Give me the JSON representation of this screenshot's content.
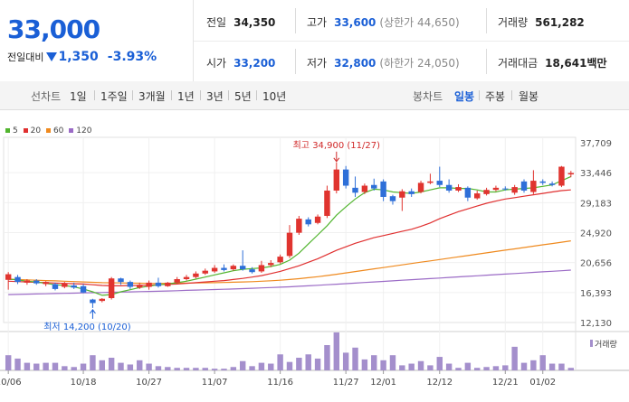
{
  "summary": {
    "price": "33,000",
    "change_label": "전일대비",
    "change_value": "1,350",
    "change_pct": "-3.93%",
    "prev_close": {
      "label": "전일",
      "value": "34,350"
    },
    "high": {
      "label": "고가",
      "value": "33,600",
      "ext": "(상한가 44,650)"
    },
    "volume": {
      "label": "거래량",
      "value": "561,282"
    },
    "open": {
      "label": "시가",
      "value": "33,200"
    },
    "low": {
      "label": "저가",
      "value": "32,800",
      "ext": "(하한가 24,050)"
    },
    "amount": {
      "label": "거래대금",
      "value": "18,641",
      "unit": "백만"
    }
  },
  "toolbar": {
    "line_label": "선차트",
    "line_periods": [
      "1일",
      "1주일",
      "3개월",
      "1년",
      "3년",
      "5년",
      "10년"
    ],
    "candle_label": "봉차트",
    "candle_periods": [
      "일봉",
      "주봉",
      "월봉"
    ],
    "candle_selected": "일봉"
  },
  "chart_data": {
    "type": "candlestick",
    "ma_legend": [
      {
        "name": "5",
        "color": "#52b52f"
      },
      {
        "name": "20",
        "color": "#e03030"
      },
      {
        "name": "60",
        "color": "#ef8a1f"
      },
      {
        "name": "120",
        "color": "#9b6bc6"
      }
    ],
    "y_ticks": [
      "37,709",
      "33,446",
      "29,183",
      "24,920",
      "20,656",
      "16,393",
      "12,130"
    ],
    "y_range": [
      12130,
      37709
    ],
    "x_ticks": [
      {
        "label": "10/06",
        "index": 0
      },
      {
        "label": "10/18",
        "index": 8
      },
      {
        "label": "10/27",
        "index": 15
      },
      {
        "label": "11/07",
        "index": 22
      },
      {
        "label": "11/16",
        "index": 29
      },
      {
        "label": "11/27",
        "index": 36
      },
      {
        "label": "12/01",
        "index": 40
      },
      {
        "label": "12/12",
        "index": 46
      },
      {
        "label": "12/21",
        "index": 53
      },
      {
        "label": "01/02",
        "index": 57
      }
    ],
    "volume_label": "거래량",
    "annotations": {
      "high": {
        "text": "최고 34,900 (11/27)",
        "index": 35,
        "value": 34900
      },
      "low": {
        "text": "최저 14,200 (10/20)",
        "index": 9,
        "value": 14200
      }
    },
    "candles": [
      {
        "o": 18200,
        "c": 19000,
        "h": 19300,
        "l": 16800
      },
      {
        "o": 18600,
        "c": 17900,
        "h": 18900,
        "l": 17600
      },
      {
        "o": 17800,
        "c": 18100,
        "h": 18300,
        "l": 17500
      },
      {
        "o": 18100,
        "c": 17700,
        "h": 18300,
        "l": 17500
      },
      {
        "o": 17600,
        "c": 17900,
        "h": 18000,
        "l": 17300
      },
      {
        "o": 17600,
        "c": 16900,
        "h": 17800,
        "l": 16700
      },
      {
        "o": 17200,
        "c": 17700,
        "h": 17900,
        "l": 17000
      },
      {
        "o": 17400,
        "c": 17100,
        "h": 17800,
        "l": 16900
      },
      {
        "o": 17300,
        "c": 16400,
        "h": 17600,
        "l": 16300
      },
      {
        "o": 15400,
        "c": 14900,
        "h": 15500,
        "l": 14200
      },
      {
        "o": 15200,
        "c": 15500,
        "h": 15600,
        "l": 15000
      },
      {
        "o": 15600,
        "c": 18400,
        "h": 18600,
        "l": 15400
      },
      {
        "o": 18400,
        "c": 17900,
        "h": 18500,
        "l": 17500
      },
      {
        "o": 17900,
        "c": 17200,
        "h": 18100,
        "l": 16900
      },
      {
        "o": 17100,
        "c": 17500,
        "h": 17800,
        "l": 16900
      },
      {
        "o": 17200,
        "c": 17800,
        "h": 18100,
        "l": 16800
      },
      {
        "o": 17800,
        "c": 17300,
        "h": 18500,
        "l": 17100
      },
      {
        "o": 17300,
        "c": 17800,
        "h": 17900,
        "l": 17200
      },
      {
        "o": 17800,
        "c": 18300,
        "h": 18600,
        "l": 17600
      },
      {
        "o": 18300,
        "c": 18600,
        "h": 18900,
        "l": 18100
      },
      {
        "o": 18600,
        "c": 19100,
        "h": 19400,
        "l": 18400
      },
      {
        "o": 19100,
        "c": 19500,
        "h": 19800,
        "l": 18900
      },
      {
        "o": 19400,
        "c": 19900,
        "h": 20300,
        "l": 19200
      },
      {
        "o": 19900,
        "c": 19600,
        "h": 20400,
        "l": 19400
      },
      {
        "o": 19700,
        "c": 20200,
        "h": 20400,
        "l": 19500
      },
      {
        "o": 20200,
        "c": 19700,
        "h": 22400,
        "l": 19500
      },
      {
        "o": 19700,
        "c": 19300,
        "h": 20000,
        "l": 19100
      },
      {
        "o": 19400,
        "c": 20300,
        "h": 20900,
        "l": 19200
      },
      {
        "o": 20300,
        "c": 20600,
        "h": 21000,
        "l": 20000
      },
      {
        "o": 20700,
        "c": 21500,
        "h": 21800,
        "l": 20500
      },
      {
        "o": 21600,
        "c": 24900,
        "h": 26000,
        "l": 21300
      },
      {
        "o": 24900,
        "c": 26900,
        "h": 27300,
        "l": 24600
      },
      {
        "o": 26800,
        "c": 26100,
        "h": 27100,
        "l": 25800
      },
      {
        "o": 26300,
        "c": 27200,
        "h": 27500,
        "l": 26100
      },
      {
        "o": 27300,
        "c": 30900,
        "h": 31600,
        "l": 27000
      },
      {
        "o": 30900,
        "c": 33900,
        "h": 34900,
        "l": 30500
      },
      {
        "o": 33900,
        "c": 31600,
        "h": 34400,
        "l": 31200
      },
      {
        "o": 31300,
        "c": 30600,
        "h": 32900,
        "l": 30000
      },
      {
        "o": 30700,
        "c": 31600,
        "h": 31900,
        "l": 30400
      },
      {
        "o": 31700,
        "c": 31200,
        "h": 32600,
        "l": 30900
      },
      {
        "o": 32200,
        "c": 30000,
        "h": 32500,
        "l": 29400
      },
      {
        "o": 30100,
        "c": 29400,
        "h": 30300,
        "l": 28900
      },
      {
        "o": 29900,
        "c": 30800,
        "h": 31100,
        "l": 28000
      },
      {
        "o": 30800,
        "c": 30400,
        "h": 31200,
        "l": 30000
      },
      {
        "o": 30700,
        "c": 32000,
        "h": 32300,
        "l": 30500
      },
      {
        "o": 32000,
        "c": 32200,
        "h": 33300,
        "l": 31800
      },
      {
        "o": 32300,
        "c": 31700,
        "h": 34300,
        "l": 31400
      },
      {
        "o": 31700,
        "c": 30900,
        "h": 32500,
        "l": 30600
      },
      {
        "o": 30900,
        "c": 31400,
        "h": 31800,
        "l": 30700
      },
      {
        "o": 31300,
        "c": 29900,
        "h": 31500,
        "l": 29400
      },
      {
        "o": 29800,
        "c": 30500,
        "h": 30900,
        "l": 29600
      },
      {
        "o": 30400,
        "c": 31000,
        "h": 31300,
        "l": 30200
      },
      {
        "o": 31000,
        "c": 31300,
        "h": 31600,
        "l": 30800
      },
      {
        "o": 31200,
        "c": 31100,
        "h": 31500,
        "l": 30900
      },
      {
        "o": 30600,
        "c": 31400,
        "h": 31700,
        "l": 30300
      },
      {
        "o": 32200,
        "c": 30900,
        "h": 32500,
        "l": 30600
      },
      {
        "o": 30700,
        "c": 32300,
        "h": 33800,
        "l": 30400
      },
      {
        "o": 32200,
        "c": 32000,
        "h": 32500,
        "l": 31700
      },
      {
        "o": 31900,
        "c": 31700,
        "h": 32200,
        "l": 31500
      },
      {
        "o": 31600,
        "c": 34300,
        "h": 34400,
        "l": 31400
      },
      {
        "o": 33200,
        "c": 33400,
        "h": 33700,
        "l": 32800
      }
    ],
    "volumes": [
      18,
      14,
      9,
      8,
      9,
      9,
      5,
      4,
      8,
      18,
      12,
      15,
      9,
      7,
      12,
      8,
      5,
      4,
      3,
      3,
      3,
      3,
      2,
      2,
      4,
      11,
      5,
      9,
      8,
      19,
      10,
      15,
      19,
      14,
      30,
      45,
      21,
      27,
      13,
      18,
      12,
      18,
      6,
      8,
      11,
      6,
      16,
      8,
      3,
      9,
      3,
      4,
      5,
      6,
      28,
      9,
      12,
      18,
      8,
      8,
      3
    ],
    "ma5": [
      18300,
      18200,
      18000,
      17900,
      17700,
      17500,
      17400,
      17200,
      16900,
      16500,
      16000,
      16100,
      16500,
      16800,
      17100,
      17300,
      17500,
      17600,
      17800,
      18000,
      18300,
      18600,
      18900,
      19200,
      19500,
      19700,
      19800,
      19900,
      20100,
      20400,
      21000,
      22000,
      23300,
      24600,
      25900,
      27400,
      28600,
      29700,
      30600,
      31100,
      31000,
      30700,
      30600,
      30500,
      30700,
      31000,
      31300,
      31300,
      31200,
      31200,
      31000,
      30700,
      30700,
      31000,
      31100,
      31200,
      31300,
      31500,
      31700,
      32300,
      32900
    ],
    "ma20": [
      18000,
      17950,
      17900,
      17850,
      17800,
      17750,
      17700,
      17650,
      17600,
      17500,
      17400,
      17350,
      17350,
      17400,
      17400,
      17450,
      17500,
      17550,
      17600,
      17700,
      17800,
      17900,
      18000,
      18100,
      18250,
      18400,
      18600,
      18800,
      19100,
      19400,
      19800,
      20200,
      20700,
      21200,
      21800,
      22400,
      22900,
      23400,
      23800,
      24200,
      24500,
      24800,
      25100,
      25400,
      25800,
      26300,
      26900,
      27400,
      27900,
      28300,
      28700,
      29100,
      29400,
      29700,
      29900,
      30100,
      30300,
      30500,
      30700,
      30900,
      31000
    ],
    "ma60": [
      18300,
      18250,
      18200,
      18150,
      18100,
      18050,
      18000,
      17950,
      17900,
      17850,
      17800,
      17780,
      17760,
      17740,
      17720,
      17700,
      17700,
      17710,
      17720,
      17740,
      17760,
      17780,
      17800,
      17830,
      17860,
      17900,
      17940,
      18000,
      18070,
      18150,
      18250,
      18370,
      18500,
      18650,
      18820,
      19000,
      19190,
      19380,
      19570,
      19760,
      19950,
      20140,
      20330,
      20520,
      20710,
      20900,
      21090,
      21280,
      21470,
      21660,
      21850,
      22040,
      22230,
      22420,
      22610,
      22800,
      22990,
      23180,
      23370,
      23560,
      23750
    ],
    "ma120": [
      16100,
      16130,
      16160,
      16190,
      16220,
      16250,
      16280,
      16310,
      16340,
      16370,
      16400,
      16430,
      16460,
      16490,
      16520,
      16550,
      16580,
      16620,
      16660,
      16700,
      16740,
      16780,
      16820,
      16860,
      16900,
      16950,
      17000,
      17050,
      17100,
      17150,
      17210,
      17280,
      17350,
      17420,
      17500,
      17580,
      17660,
      17740,
      17820,
      17900,
      17980,
      18060,
      18140,
      18220,
      18300,
      18380,
      18460,
      18540,
      18620,
      18700,
      18780,
      18860,
      18940,
      19020,
      19100,
      19180,
      19260,
      19340,
      19420,
      19500,
      19580
    ]
  }
}
